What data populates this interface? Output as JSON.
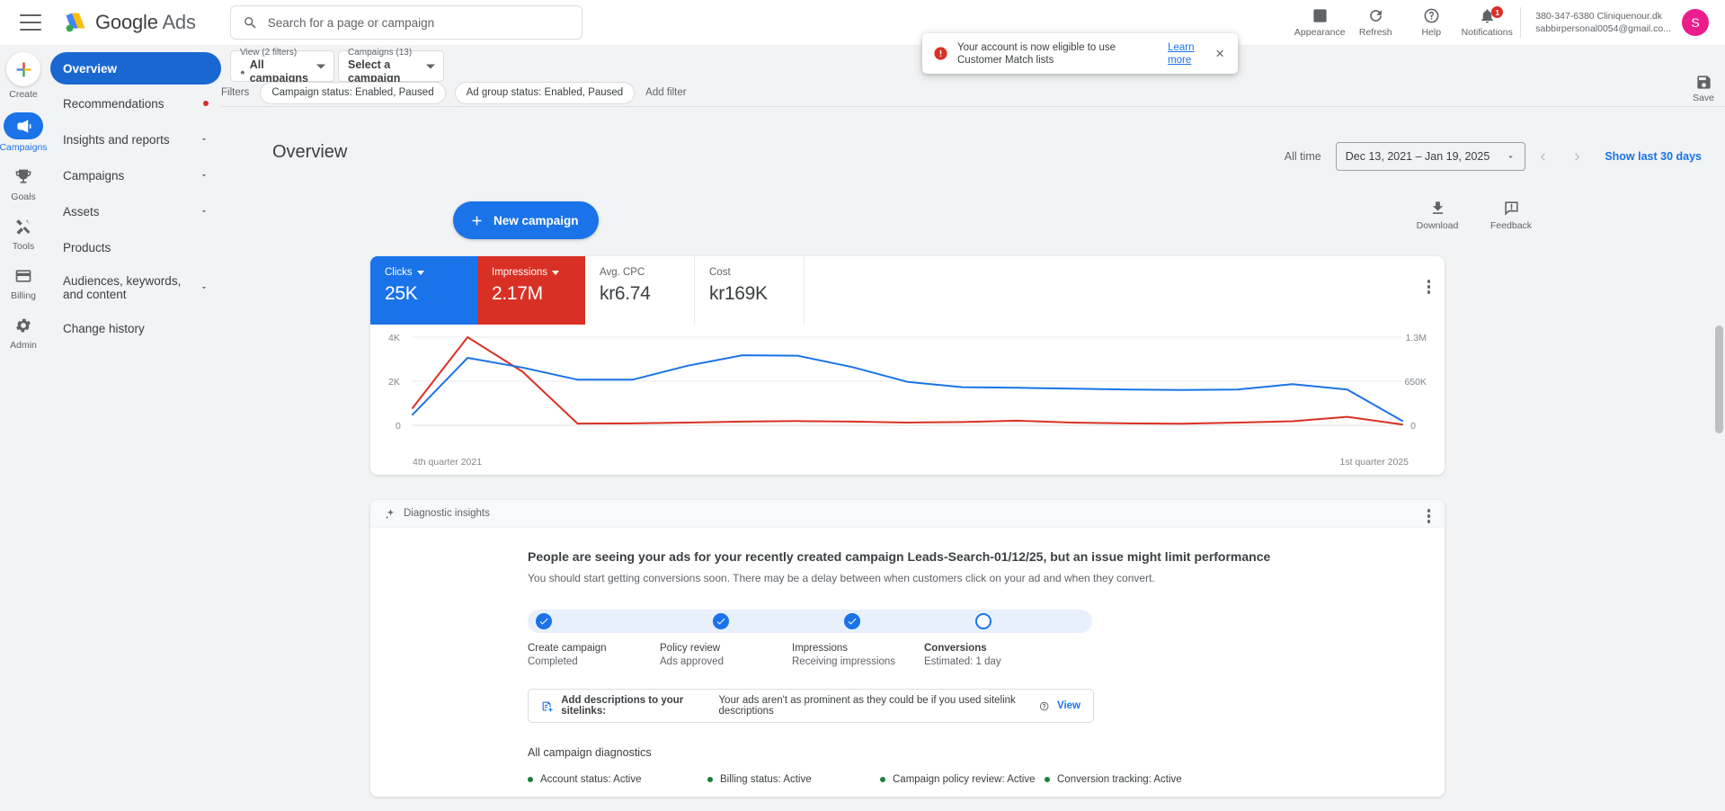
{
  "topbar": {
    "menu_icon": "hamburger-menu-icon",
    "brand_google": "Google",
    "brand_ads": "Ads",
    "search_placeholder": "Search for a page or campaign",
    "search_value": "",
    "icons": [
      {
        "name": "appearance-icon",
        "label": "Appearance"
      },
      {
        "name": "refresh-icon",
        "label": "Refresh"
      },
      {
        "name": "help-icon",
        "label": "Help"
      },
      {
        "name": "notifications-icon",
        "label": "Notifications",
        "badge": "1"
      }
    ],
    "account_id": "380-347-6380 Cliniquenour.dk",
    "account_email": "sabbirpersonal0054@gmail.co...",
    "avatar_initial": "S"
  },
  "toast": {
    "icon": "error-circle-icon",
    "message": "Your account is now eligible to use Customer Match lists",
    "link": "Learn more",
    "close": "×"
  },
  "rail": [
    {
      "name": "create",
      "label": "Create",
      "icon": "plus-icon",
      "active": false
    },
    {
      "name": "campaigns",
      "label": "Campaigns",
      "icon": "megaphone-icon",
      "active": true
    },
    {
      "name": "goals",
      "label": "Goals",
      "icon": "trophy-icon",
      "active": false
    },
    {
      "name": "tools",
      "label": "Tools",
      "icon": "tools-icon",
      "active": false
    },
    {
      "name": "billing",
      "label": "Billing",
      "icon": "credit-card-icon",
      "active": false
    },
    {
      "name": "admin",
      "label": "Admin",
      "icon": "gear-icon",
      "active": false
    }
  ],
  "sidebar": [
    {
      "label": "Overview",
      "active": true,
      "dot": false,
      "chevron": false
    },
    {
      "label": "Recommendations",
      "active": false,
      "dot": true,
      "chevron": false
    },
    {
      "label": "Insights and reports",
      "active": false,
      "dot": false,
      "chevron": true
    },
    {
      "label": "Campaigns",
      "active": false,
      "dot": false,
      "chevron": true
    },
    {
      "label": "Assets",
      "active": false,
      "dot": false,
      "chevron": true
    },
    {
      "label": "Products",
      "active": false,
      "dot": false,
      "chevron": false
    },
    {
      "label": "Audiences, keywords, and content",
      "active": false,
      "dot": false,
      "chevron": true
    },
    {
      "label": "Change history",
      "active": false,
      "dot": false,
      "chevron": false
    }
  ],
  "controls": {
    "view_label": "View (2 filters)",
    "view_value": "All campaigns",
    "view_icon": "home-icon",
    "campaigns_label": "Campaigns (13)",
    "campaigns_value": "Select a campaign",
    "filters_label": "Filters",
    "chips": [
      "Campaign status: Enabled, Paused",
      "Ad group status: Enabled, Paused"
    ],
    "add_filter": "Add filter",
    "save_label": "Save",
    "save_icon": "save-disk-icon"
  },
  "header": {
    "title": "Overview",
    "all_time": "All time",
    "date_range": "Dec 13, 2021 – Jan 19, 2025",
    "prev_icon": "chevron-left-icon",
    "next_icon": "chevron-right-icon",
    "show_last_30": "Show last 30 days"
  },
  "actions": {
    "new_campaign": "New campaign",
    "new_campaign_icon": "plus-icon",
    "download": "Download",
    "download_icon": "download-icon",
    "feedback": "Feedback",
    "feedback_icon": "feedback-icon"
  },
  "metrics": [
    {
      "name": "Clicks",
      "value": "25K",
      "selected": true,
      "color": "#1a73e8",
      "has_caret": true
    },
    {
      "name": "Impressions",
      "value": "2.17M",
      "selected": true,
      "color": "#d93025",
      "has_caret": true
    },
    {
      "name": "Avg. CPC",
      "value": "kr6.74",
      "selected": false,
      "has_caret": false
    },
    {
      "name": "Cost",
      "value": "kr169K",
      "selected": false,
      "has_caret": false
    }
  ],
  "chart_data": {
    "type": "line",
    "title": "",
    "xlabel": "",
    "ylabel": "",
    "grid": true,
    "legend_position": "none",
    "x_tick_labels": [
      "4th quarter 2021",
      "1st quarter 2025"
    ],
    "left_axis": {
      "name": "Clicks",
      "ticks": [
        "0",
        "2K",
        "4K"
      ],
      "ylim": [
        0,
        4000
      ]
    },
    "right_axis": {
      "name": "Impressions",
      "ticks": [
        "0",
        "650K",
        "1.3M"
      ],
      "ylim": [
        0,
        1300000
      ]
    },
    "series": [
      {
        "name": "Clicks",
        "color": "#1a73e8",
        "axis": "left",
        "values": [
          480,
          3060,
          2620,
          2070,
          2070,
          2700,
          3180,
          3160,
          2640,
          1970,
          1730,
          1700,
          1660,
          1620,
          1600,
          1620,
          1870,
          1620,
          200
        ]
      },
      {
        "name": "Impressions",
        "color": "#d93025",
        "axis": "right",
        "values": [
          255000,
          1300000,
          790000,
          25000,
          28000,
          40000,
          55000,
          62000,
          55000,
          40000,
          48000,
          68000,
          40000,
          28000,
          22000,
          40000,
          60000,
          125000,
          12000
        ]
      }
    ]
  },
  "diagnostics": {
    "panel_label": "Diagnostic insights",
    "panel_icon": "sparkle-icon",
    "kebab_icon": "more-vert-icon",
    "title": "People are seeing your ads for your recently created campaign Leads-Search-01/12/25, but an issue might limit performance",
    "subtitle": "You should start getting conversions soon. There may be a delay between when customers click on your ad and when they convert.",
    "steps": [
      {
        "name": "Create campaign",
        "status": "Completed",
        "state": "done"
      },
      {
        "name": "Policy review",
        "status": "Ads approved",
        "state": "done"
      },
      {
        "name": "Impressions",
        "status": "Receiving impressions",
        "state": "done"
      },
      {
        "name": "Conversions",
        "status": "Estimated: 1 day",
        "state": "pending"
      }
    ],
    "sitelink": {
      "icon": "sitelink-icon",
      "strong": "Add descriptions to your sitelinks:",
      "text": "Your ads aren't as prominent as they could be if you used sitelink descriptions",
      "help_icon": "help-circle-icon",
      "view": "View"
    },
    "all_title": "All campaign diagnostics",
    "items": [
      "Account status: Active",
      "Billing status: Active",
      "Campaign policy review: Active",
      "Conversion tracking: Active"
    ]
  }
}
